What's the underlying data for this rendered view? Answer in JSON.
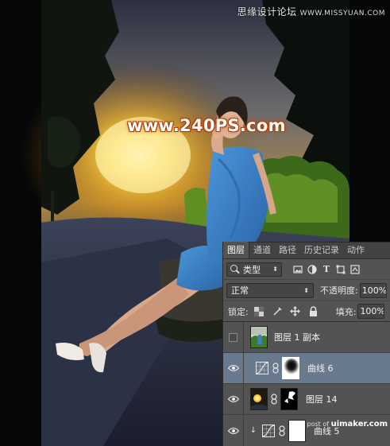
{
  "watermarks": {
    "top_right_cn": "思缘设计论坛",
    "top_right_url": "WWW.MISSYUAN.COM",
    "center": "www.240PS.com",
    "bottom_prefix": "post of",
    "bottom_site": "uimaker.com"
  },
  "layers_panel": {
    "tabs": [
      {
        "label": "图层",
        "active": true
      },
      {
        "label": "通道",
        "active": false
      },
      {
        "label": "路径",
        "active": false
      },
      {
        "label": "历史记录",
        "active": false
      },
      {
        "label": "动作",
        "active": false
      }
    ],
    "filter": {
      "label": "类型"
    },
    "filter_icons": [
      "image-filter-icon",
      "adjustment-filter-icon",
      "type-filter-icon",
      "shape-filter-icon",
      "smart-object-filter-icon"
    ],
    "blend_mode": "正常",
    "opacity_label": "不透明度:",
    "opacity_value": "100%",
    "lock_label": "锁定:",
    "fill_label": "填充:",
    "fill_value": "100%",
    "layers": [
      {
        "name": "图层 1 副本",
        "visible": false,
        "selected": false,
        "kind": "pixel"
      },
      {
        "name": "曲线 6",
        "visible": true,
        "selected": true,
        "kind": "curves"
      },
      {
        "name": "图层 14",
        "visible": true,
        "selected": false,
        "kind": "pixel-mask"
      },
      {
        "name": "曲线 5",
        "visible": true,
        "selected": false,
        "kind": "curves-clipped"
      }
    ]
  },
  "colors": {
    "panel_bg": "#535353",
    "selected_layer": "#6a7a8e",
    "glow": "#ffd23a",
    "dress": "#3b82c4"
  }
}
